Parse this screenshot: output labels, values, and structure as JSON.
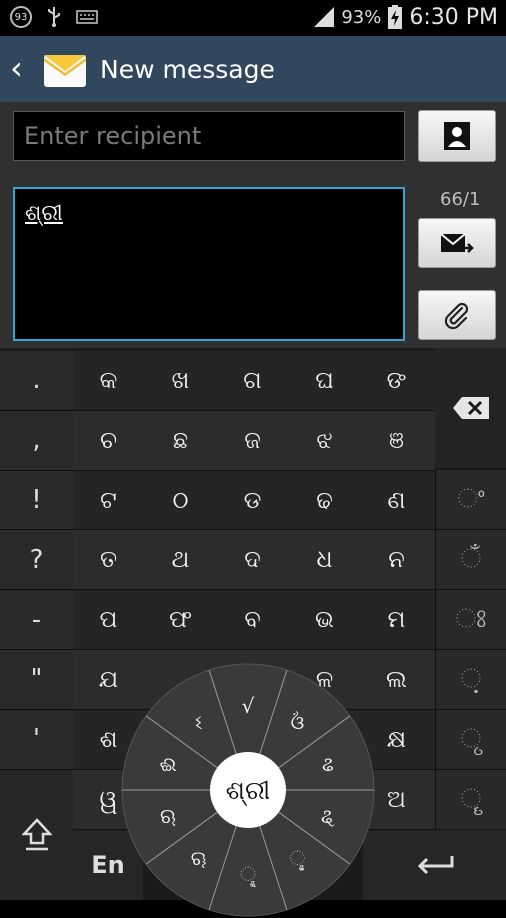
{
  "status_bar": {
    "notification_count": "93",
    "battery_percent": "93%",
    "time": "6:30 PM",
    "icons": [
      "usb-icon",
      "keyboard-icon",
      "signal-icon",
      "battery-charging-icon"
    ]
  },
  "action_bar": {
    "title": "New message",
    "back_icon": "chevron-left-icon",
    "app_icon": "envelope-icon",
    "color": "#31475e"
  },
  "compose": {
    "recipient_placeholder": "Enter recipient",
    "message_text": "ଶ୍ରୀ",
    "char_counter": "66/1",
    "focus_color": "#30a6d8"
  },
  "keyboard": {
    "punctuation_keys": [
      ".",
      ",",
      "!",
      "?",
      "-",
      "\"",
      "'"
    ],
    "consonant_rows": [
      [
        "କ",
        "ଖ",
        "ଗ",
        "ଘ",
        "ଙ"
      ],
      [
        "ଚ",
        "ଛ",
        "ଜ",
        "ଝ",
        "ଞ"
      ],
      [
        "ଟ",
        "ଠ",
        "ଡ",
        "ଢ",
        "ଣ"
      ],
      [
        "ତ",
        "ଥ",
        "ଦ",
        "ଧ",
        "ନ"
      ],
      [
        "ପ",
        "ଫ",
        "ବ",
        "ଭ",
        "ମ"
      ],
      [
        "ଯ",
        "",
        "",
        "ଳ",
        "ଲ"
      ],
      [
        "ଶ",
        "",
        "",
        "",
        "କ୍ଷ"
      ],
      [
        "ୱ",
        "",
        "",
        "",
        "ଅ"
      ]
    ],
    "diacritic_keys": [
      "◌ଂ",
      "◌ଁ",
      "◌ଃ",
      "◌଼",
      "◌ୃ",
      "◌ୄ"
    ],
    "language_label": "En",
    "wheel": {
      "center": "ଶ୍ରୀ",
      "options": [
        "√",
        "ଓଁ",
        "ଌ",
        "ୡ",
        "ୢ",
        "ୣ",
        "ୠ",
        "ଋ",
        "ଈ",
        "ଽ"
      ]
    }
  }
}
